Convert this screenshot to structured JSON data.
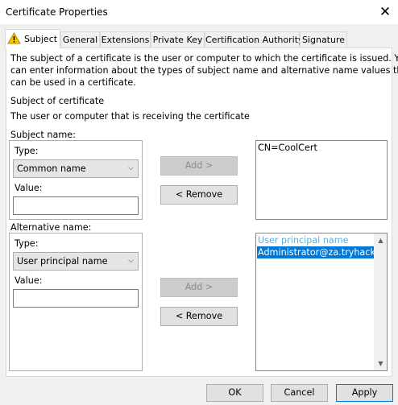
{
  "window": {
    "title": "Certificate Properties",
    "close": "✕"
  },
  "tabs": [
    "Subject",
    "General",
    "Extensions",
    "Private Key",
    "Certification Authority",
    "Signature"
  ],
  "intro": {
    "lines": [
      "The subject of a certificate is the user or computer to which the certificate is issued. You",
      "can enter information about the types of subject name and alternative name values that",
      "can be used in a certificate."
    ]
  },
  "subject_of_cert": {
    "heading": "Subject of certificate",
    "text": "The user or computer that is receiving the certificate"
  },
  "subject_name": {
    "label": "Subject name:",
    "type_label": "Type:",
    "type_value": "Common name",
    "value_label": "Value:",
    "value": "",
    "add": "Add >",
    "remove": "< Remove",
    "list": [
      "CN=CoolCert"
    ]
  },
  "alt_name": {
    "label": "Alternative name:",
    "type_label": "Type:",
    "type_value": "User principal name",
    "value_label": "Value:",
    "value": "",
    "add": "Add >",
    "remove": "< Remove",
    "list_header": "User principal name",
    "list_selected": "Administrator@za.tryhackme.lo"
  },
  "buttons": {
    "ok": "OK",
    "cancel": "Cancel",
    "apply": "Apply"
  }
}
